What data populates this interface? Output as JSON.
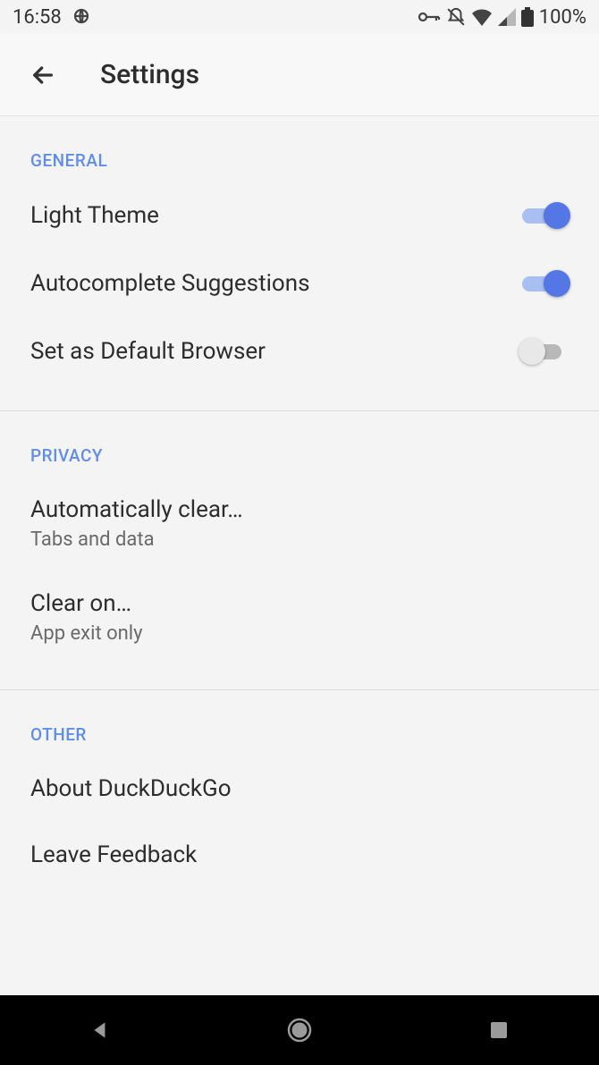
{
  "statusbar": {
    "time": "16:58",
    "battery": "100%"
  },
  "appbar": {
    "title": "Settings"
  },
  "sections": {
    "general": {
      "header": "GENERAL",
      "light_theme": {
        "label": "Light Theme",
        "on": true
      },
      "autocomplete": {
        "label": "Autocomplete Suggestions",
        "on": true
      },
      "default_browser": {
        "label": "Set as Default Browser",
        "on": false
      }
    },
    "privacy": {
      "header": "PRIVACY",
      "auto_clear": {
        "label": "Automatically clear…",
        "sub": "Tabs and data"
      },
      "clear_on": {
        "label": "Clear on…",
        "sub": "App exit only"
      }
    },
    "other": {
      "header": "OTHER",
      "about": {
        "label": "About DuckDuckGo"
      },
      "feedback": {
        "label": "Leave Feedback"
      }
    }
  }
}
